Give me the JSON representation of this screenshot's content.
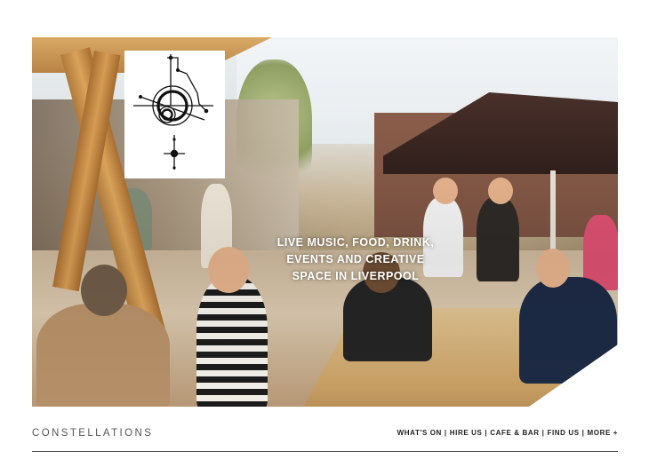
{
  "hero": {
    "tagline": "LIVE MUSIC, FOOD, DRINK,\nEVENTS AND CREATIVE\nSPACE IN LIVERPOOL"
  },
  "logo": {
    "icon": "constellations-logo-icon"
  },
  "footer": {
    "brand": "CONSTELLATIONS",
    "nav": [
      {
        "label": "WHAT'S ON"
      },
      {
        "label": "HIRE US"
      },
      {
        "label": "CAFE & BAR"
      },
      {
        "label": "FIND US"
      },
      {
        "label": "MORE +"
      }
    ],
    "separator": "|"
  },
  "colors": {
    "text_dark": "#222222",
    "brand_text": "#555555",
    "rule": "#4a4a4a",
    "background": "#ffffff"
  }
}
